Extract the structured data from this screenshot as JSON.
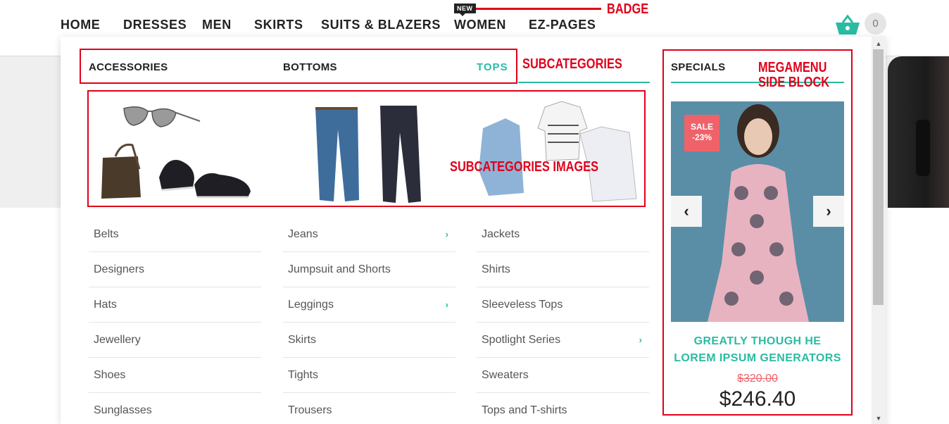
{
  "nav": {
    "items": [
      "HOME",
      "DRESSES",
      "MEN",
      "SKIRTS",
      "SUITS & BLAZERS",
      "WOMEN",
      "EZ-PAGES"
    ],
    "new_badge": "NEW",
    "cart_count": "0"
  },
  "annotations": {
    "badge": "BADGE",
    "subcategories": "SUBCATEGORIES",
    "megamenu_side_block_1": "MEGAMENU",
    "megamenu_side_block_2": "SIDE BLOCK",
    "subcategories_images": "SUBCATEGORIES IMAGES"
  },
  "megamenu": {
    "columns": [
      {
        "heading": "ACCESSORIES",
        "items": [
          {
            "label": "Belts",
            "has_children": false
          },
          {
            "label": "Designers",
            "has_children": false
          },
          {
            "label": "Hats",
            "has_children": false
          },
          {
            "label": "Jewellery",
            "has_children": false
          },
          {
            "label": "Shoes",
            "has_children": false
          },
          {
            "label": "Sunglasses",
            "has_children": false
          }
        ]
      },
      {
        "heading": "BOTTOMS",
        "items": [
          {
            "label": "Jeans",
            "has_children": true
          },
          {
            "label": "Jumpsuit and Shorts",
            "has_children": false
          },
          {
            "label": "Leggings",
            "has_children": true
          },
          {
            "label": "Skirts",
            "has_children": false
          },
          {
            "label": "Tights",
            "has_children": false
          },
          {
            "label": "Trousers",
            "has_children": false
          }
        ]
      },
      {
        "heading": "TOPS",
        "items": [
          {
            "label": "Jackets",
            "has_children": false
          },
          {
            "label": "Shirts",
            "has_children": false
          },
          {
            "label": "Sleeveless Tops",
            "has_children": false
          },
          {
            "label": "Spotlight Series",
            "has_children": true
          },
          {
            "label": "Sweaters",
            "has_children": false
          },
          {
            "label": "Tops and T-shirts",
            "has_children": false
          }
        ]
      }
    ],
    "specials": {
      "heading": "SPECIALS",
      "sale_line1": "SALE",
      "sale_line2": "-23%",
      "product_name_line1": "GREATLY THOUGH HE",
      "product_name_line2": "LOREM IPSUM GENERATORS",
      "old_price": "$320.00",
      "price": "$246.40"
    }
  },
  "colors": {
    "accent": "#2abba3",
    "annotation": "#e0001a",
    "sale": "#f0626a"
  }
}
